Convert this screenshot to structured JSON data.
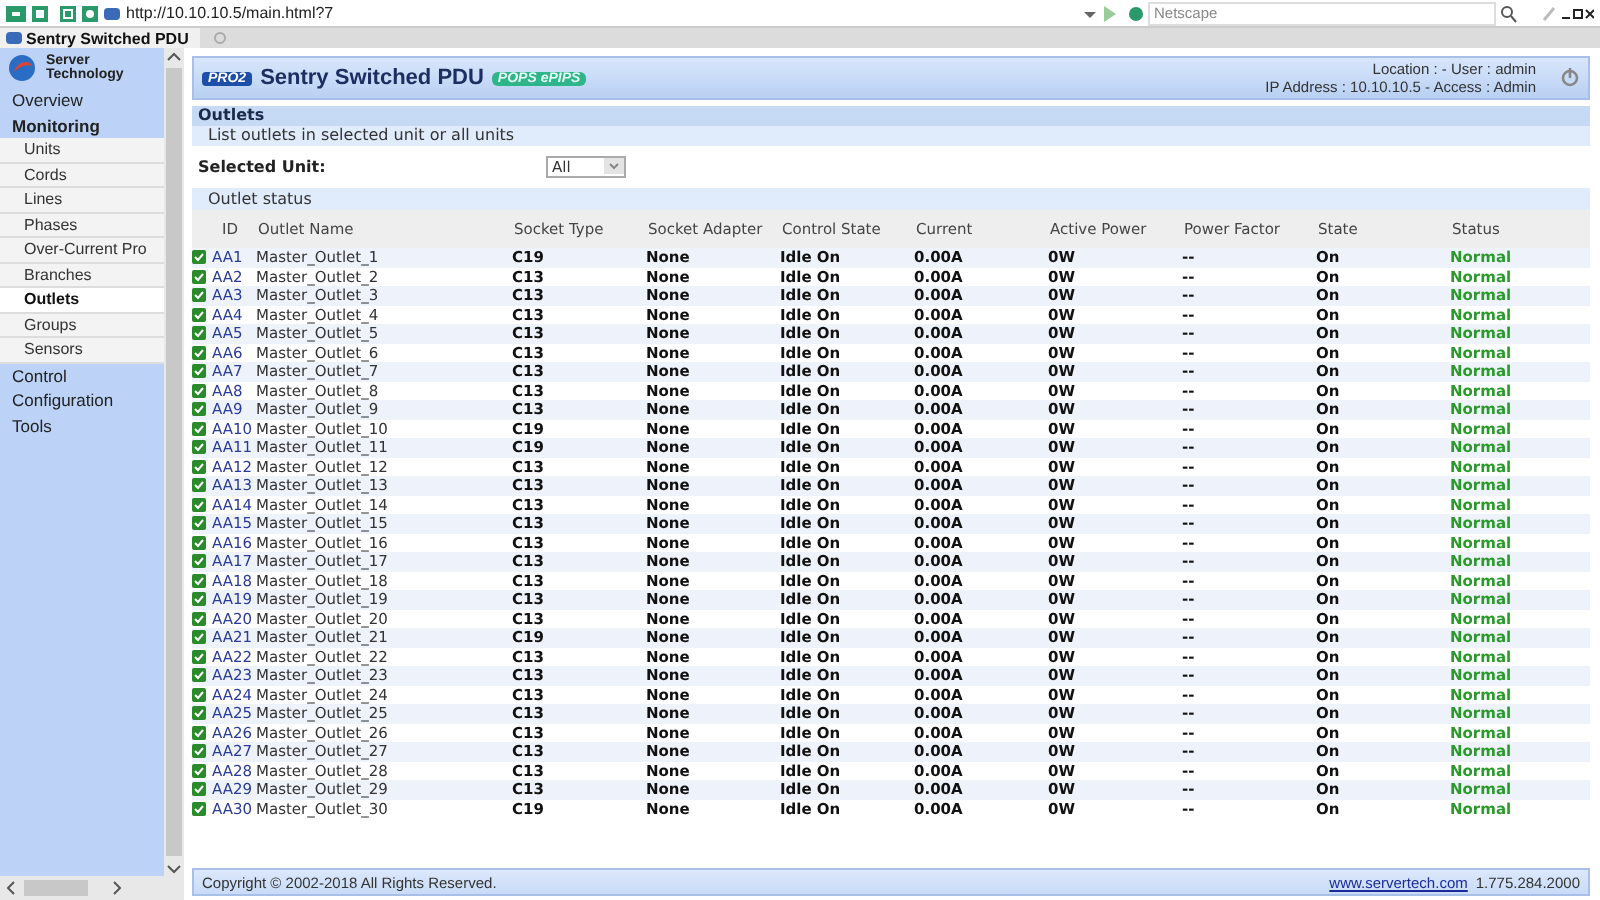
{
  "browser": {
    "url": "http://10.10.10.5/main.html?7",
    "search": {
      "placeholder": "Netscape"
    },
    "tab": "Sentry Switched PDU"
  },
  "sidebar": {
    "brand": "Server Technology",
    "items": [
      {
        "label": "Overview",
        "selected": false
      },
      {
        "label": "Monitoring",
        "expanded": true,
        "children": [
          {
            "label": "Units",
            "selected": false
          },
          {
            "label": "Cords",
            "selected": false
          },
          {
            "label": "Lines",
            "selected": false
          },
          {
            "label": "Phases",
            "selected": false
          },
          {
            "label": "Over-Current Pro",
            "selected": false
          },
          {
            "label": "Branches",
            "selected": false
          },
          {
            "label": "Outlets",
            "selected": true
          },
          {
            "label": "Groups",
            "selected": false
          },
          {
            "label": "Sensors",
            "selected": false
          }
        ]
      },
      {
        "label": "Control",
        "selected": false
      },
      {
        "label": "Configuration",
        "selected": false
      },
      {
        "label": "Tools",
        "selected": false
      }
    ]
  },
  "header": {
    "badge": "PRO2",
    "title": "Sentry Switched PDU",
    "tag": "POPS ePIPS",
    "info_line_1": "Location :  - User : admin",
    "info_line_2": "IP Address : 10.10.10.5 - Access : Admin"
  },
  "section": {
    "title": "Outlets",
    "subtitle": "List outlets in selected unit or all units",
    "unit_label": "Selected Unit:",
    "unit_value": "All",
    "table_title": "Outlet status"
  },
  "table": {
    "columns": [
      "ID",
      "Outlet Name",
      "Socket Type",
      "Socket Adapter",
      "Control State",
      "Current",
      "Active Power",
      "Power Factor",
      "State",
      "Status"
    ],
    "rows": [
      {
        "id": "AA1",
        "name": "Master_Outlet_1",
        "socket_type": "C19",
        "socket_adapter": "None",
        "control_state": "Idle On",
        "current": "0.00A",
        "active_power": "0W",
        "power_factor": "--",
        "state": "On",
        "status": "Normal",
        "checked": true
      },
      {
        "id": "AA2",
        "name": "Master_Outlet_2",
        "socket_type": "C13",
        "socket_adapter": "None",
        "control_state": "Idle On",
        "current": "0.00A",
        "active_power": "0W",
        "power_factor": "--",
        "state": "On",
        "status": "Normal",
        "checked": true
      },
      {
        "id": "AA3",
        "name": "Master_Outlet_3",
        "socket_type": "C13",
        "socket_adapter": "None",
        "control_state": "Idle On",
        "current": "0.00A",
        "active_power": "0W",
        "power_factor": "--",
        "state": "On",
        "status": "Normal",
        "checked": true
      },
      {
        "id": "AA4",
        "name": "Master_Outlet_4",
        "socket_type": "C13",
        "socket_adapter": "None",
        "control_state": "Idle On",
        "current": "0.00A",
        "active_power": "0W",
        "power_factor": "--",
        "state": "On",
        "status": "Normal",
        "checked": true
      },
      {
        "id": "AA5",
        "name": "Master_Outlet_5",
        "socket_type": "C13",
        "socket_adapter": "None",
        "control_state": "Idle On",
        "current": "0.00A",
        "active_power": "0W",
        "power_factor": "--",
        "state": "On",
        "status": "Normal",
        "checked": true
      },
      {
        "id": "AA6",
        "name": "Master_Outlet_6",
        "socket_type": "C13",
        "socket_adapter": "None",
        "control_state": "Idle On",
        "current": "0.00A",
        "active_power": "0W",
        "power_factor": "--",
        "state": "On",
        "status": "Normal",
        "checked": true
      },
      {
        "id": "AA7",
        "name": "Master_Outlet_7",
        "socket_type": "C13",
        "socket_adapter": "None",
        "control_state": "Idle On",
        "current": "0.00A",
        "active_power": "0W",
        "power_factor": "--",
        "state": "On",
        "status": "Normal",
        "checked": true
      },
      {
        "id": "AA8",
        "name": "Master_Outlet_8",
        "socket_type": "C13",
        "socket_adapter": "None",
        "control_state": "Idle On",
        "current": "0.00A",
        "active_power": "0W",
        "power_factor": "--",
        "state": "On",
        "status": "Normal",
        "checked": true
      },
      {
        "id": "AA9",
        "name": "Master_Outlet_9",
        "socket_type": "C13",
        "socket_adapter": "None",
        "control_state": "Idle On",
        "current": "0.00A",
        "active_power": "0W",
        "power_factor": "--",
        "state": "On",
        "status": "Normal",
        "checked": true
      },
      {
        "id": "AA10",
        "name": "Master_Outlet_10",
        "socket_type": "C19",
        "socket_adapter": "None",
        "control_state": "Idle On",
        "current": "0.00A",
        "active_power": "0W",
        "power_factor": "--",
        "state": "On",
        "status": "Normal",
        "checked": true
      },
      {
        "id": "AA11",
        "name": "Master_Outlet_11",
        "socket_type": "C19",
        "socket_adapter": "None",
        "control_state": "Idle On",
        "current": "0.00A",
        "active_power": "0W",
        "power_factor": "--",
        "state": "On",
        "status": "Normal",
        "checked": true
      },
      {
        "id": "AA12",
        "name": "Master_Outlet_12",
        "socket_type": "C13",
        "socket_adapter": "None",
        "control_state": "Idle On",
        "current": "0.00A",
        "active_power": "0W",
        "power_factor": "--",
        "state": "On",
        "status": "Normal",
        "checked": true
      },
      {
        "id": "AA13",
        "name": "Master_Outlet_13",
        "socket_type": "C13",
        "socket_adapter": "None",
        "control_state": "Idle On",
        "current": "0.00A",
        "active_power": "0W",
        "power_factor": "--",
        "state": "On",
        "status": "Normal",
        "checked": true
      },
      {
        "id": "AA14",
        "name": "Master_Outlet_14",
        "socket_type": "C13",
        "socket_adapter": "None",
        "control_state": "Idle On",
        "current": "0.00A",
        "active_power": "0W",
        "power_factor": "--",
        "state": "On",
        "status": "Normal",
        "checked": true
      },
      {
        "id": "AA15",
        "name": "Master_Outlet_15",
        "socket_type": "C13",
        "socket_adapter": "None",
        "control_state": "Idle On",
        "current": "0.00A",
        "active_power": "0W",
        "power_factor": "--",
        "state": "On",
        "status": "Normal",
        "checked": true
      },
      {
        "id": "AA16",
        "name": "Master_Outlet_16",
        "socket_type": "C13",
        "socket_adapter": "None",
        "control_state": "Idle On",
        "current": "0.00A",
        "active_power": "0W",
        "power_factor": "--",
        "state": "On",
        "status": "Normal",
        "checked": true
      },
      {
        "id": "AA17",
        "name": "Master_Outlet_17",
        "socket_type": "C13",
        "socket_adapter": "None",
        "control_state": "Idle On",
        "current": "0.00A",
        "active_power": "0W",
        "power_factor": "--",
        "state": "On",
        "status": "Normal",
        "checked": true
      },
      {
        "id": "AA18",
        "name": "Master_Outlet_18",
        "socket_type": "C13",
        "socket_adapter": "None",
        "control_state": "Idle On",
        "current": "0.00A",
        "active_power": "0W",
        "power_factor": "--",
        "state": "On",
        "status": "Normal",
        "checked": true
      },
      {
        "id": "AA19",
        "name": "Master_Outlet_19",
        "socket_type": "C13",
        "socket_adapter": "None",
        "control_state": "Idle On",
        "current": "0.00A",
        "active_power": "0W",
        "power_factor": "--",
        "state": "On",
        "status": "Normal",
        "checked": true
      },
      {
        "id": "AA20",
        "name": "Master_Outlet_20",
        "socket_type": "C13",
        "socket_adapter": "None",
        "control_state": "Idle On",
        "current": "0.00A",
        "active_power": "0W",
        "power_factor": "--",
        "state": "On",
        "status": "Normal",
        "checked": true
      },
      {
        "id": "AA21",
        "name": "Master_Outlet_21",
        "socket_type": "C19",
        "socket_adapter": "None",
        "control_state": "Idle On",
        "current": "0.00A",
        "active_power": "0W",
        "power_factor": "--",
        "state": "On",
        "status": "Normal",
        "checked": true
      },
      {
        "id": "AA22",
        "name": "Master_Outlet_22",
        "socket_type": "C13",
        "socket_adapter": "None",
        "control_state": "Idle On",
        "current": "0.00A",
        "active_power": "0W",
        "power_factor": "--",
        "state": "On",
        "status": "Normal",
        "checked": true
      },
      {
        "id": "AA23",
        "name": "Master_Outlet_23",
        "socket_type": "C13",
        "socket_adapter": "None",
        "control_state": "Idle On",
        "current": "0.00A",
        "active_power": "0W",
        "power_factor": "--",
        "state": "On",
        "status": "Normal",
        "checked": true
      },
      {
        "id": "AA24",
        "name": "Master_Outlet_24",
        "socket_type": "C13",
        "socket_adapter": "None",
        "control_state": "Idle On",
        "current": "0.00A",
        "active_power": "0W",
        "power_factor": "--",
        "state": "On",
        "status": "Normal",
        "checked": true
      },
      {
        "id": "AA25",
        "name": "Master_Outlet_25",
        "socket_type": "C13",
        "socket_adapter": "None",
        "control_state": "Idle On",
        "current": "0.00A",
        "active_power": "0W",
        "power_factor": "--",
        "state": "On",
        "status": "Normal",
        "checked": true
      },
      {
        "id": "AA26",
        "name": "Master_Outlet_26",
        "socket_type": "C13",
        "socket_adapter": "None",
        "control_state": "Idle On",
        "current": "0.00A",
        "active_power": "0W",
        "power_factor": "--",
        "state": "On",
        "status": "Normal",
        "checked": true
      },
      {
        "id": "AA27",
        "name": "Master_Outlet_27",
        "socket_type": "C13",
        "socket_adapter": "None",
        "control_state": "Idle On",
        "current": "0.00A",
        "active_power": "0W",
        "power_factor": "--",
        "state": "On",
        "status": "Normal",
        "checked": true
      },
      {
        "id": "AA28",
        "name": "Master_Outlet_28",
        "socket_type": "C13",
        "socket_adapter": "None",
        "control_state": "Idle On",
        "current": "0.00A",
        "active_power": "0W",
        "power_factor": "--",
        "state": "On",
        "status": "Normal",
        "checked": true
      },
      {
        "id": "AA29",
        "name": "Master_Outlet_29",
        "socket_type": "C13",
        "socket_adapter": "None",
        "control_state": "Idle On",
        "current": "0.00A",
        "active_power": "0W",
        "power_factor": "--",
        "state": "On",
        "status": "Normal",
        "checked": true
      },
      {
        "id": "AA30",
        "name": "Master_Outlet_30",
        "socket_type": "C19",
        "socket_adapter": "None",
        "control_state": "Idle On",
        "current": "0.00A",
        "active_power": "0W",
        "power_factor": "--",
        "state": "On",
        "status": "Normal",
        "checked": true
      }
    ]
  },
  "footer": {
    "copyright": "Copyright © 2002-2018 All Rights Reserved.",
    "link": "www.servertech.com",
    "phone": "1.775.284.2000"
  }
}
